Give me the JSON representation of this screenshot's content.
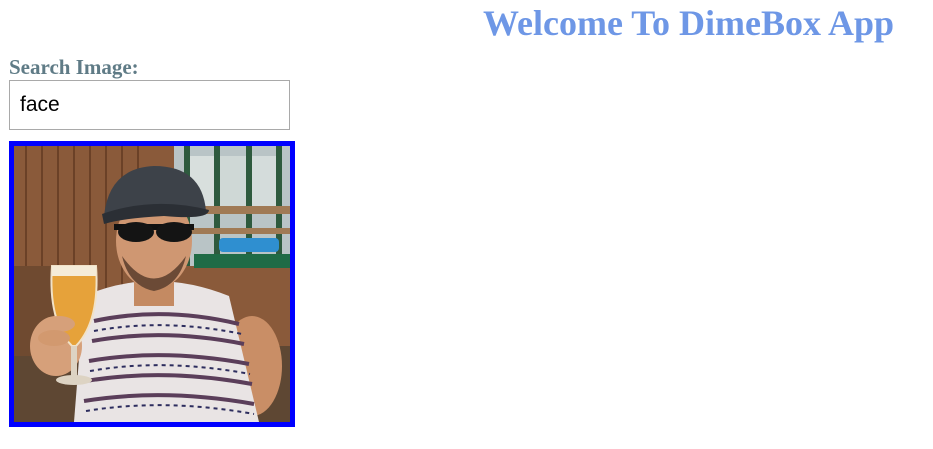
{
  "header": {
    "title": "Welcome To DimeBox App"
  },
  "search": {
    "label": "Search Image:",
    "value": "face"
  },
  "results": {
    "selected_border_color": "#0000ff",
    "items": [
      {
        "kind": "photo",
        "subject": "man in flat cap and sunglasses raising a glass of beer"
      }
    ]
  },
  "colors": {
    "title": "#6e97e6",
    "label": "#5f7b86",
    "selection_border": "#0000ff"
  }
}
